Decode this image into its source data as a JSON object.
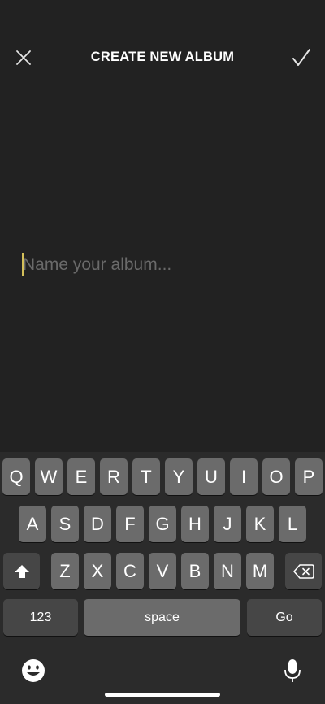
{
  "header": {
    "title": "CREATE NEW ALBUM",
    "close_icon": "close-icon",
    "confirm_icon": "checkmark-icon"
  },
  "album_name": {
    "value": "",
    "placeholder": "Name your album..."
  },
  "keyboard": {
    "row1": [
      "Q",
      "W",
      "E",
      "R",
      "T",
      "Y",
      "U",
      "I",
      "O",
      "P"
    ],
    "row2": [
      "A",
      "S",
      "D",
      "F",
      "G",
      "H",
      "J",
      "K",
      "L"
    ],
    "row3": [
      "Z",
      "X",
      "C",
      "V",
      "B",
      "N",
      "M"
    ],
    "shift_icon": "shift-icon",
    "delete_icon": "backspace-icon",
    "numbers_label": "123",
    "space_label": "space",
    "go_label": "Go",
    "emoji_icon": "emoji-icon",
    "mic_icon": "microphone-icon"
  },
  "colors": {
    "background": "#222222",
    "keyboard_background": "#2b2b2b",
    "letter_key": "#6b6b6b",
    "function_key": "#464646",
    "cursor": "#d4c05a",
    "placeholder": "#6a6a6a"
  }
}
